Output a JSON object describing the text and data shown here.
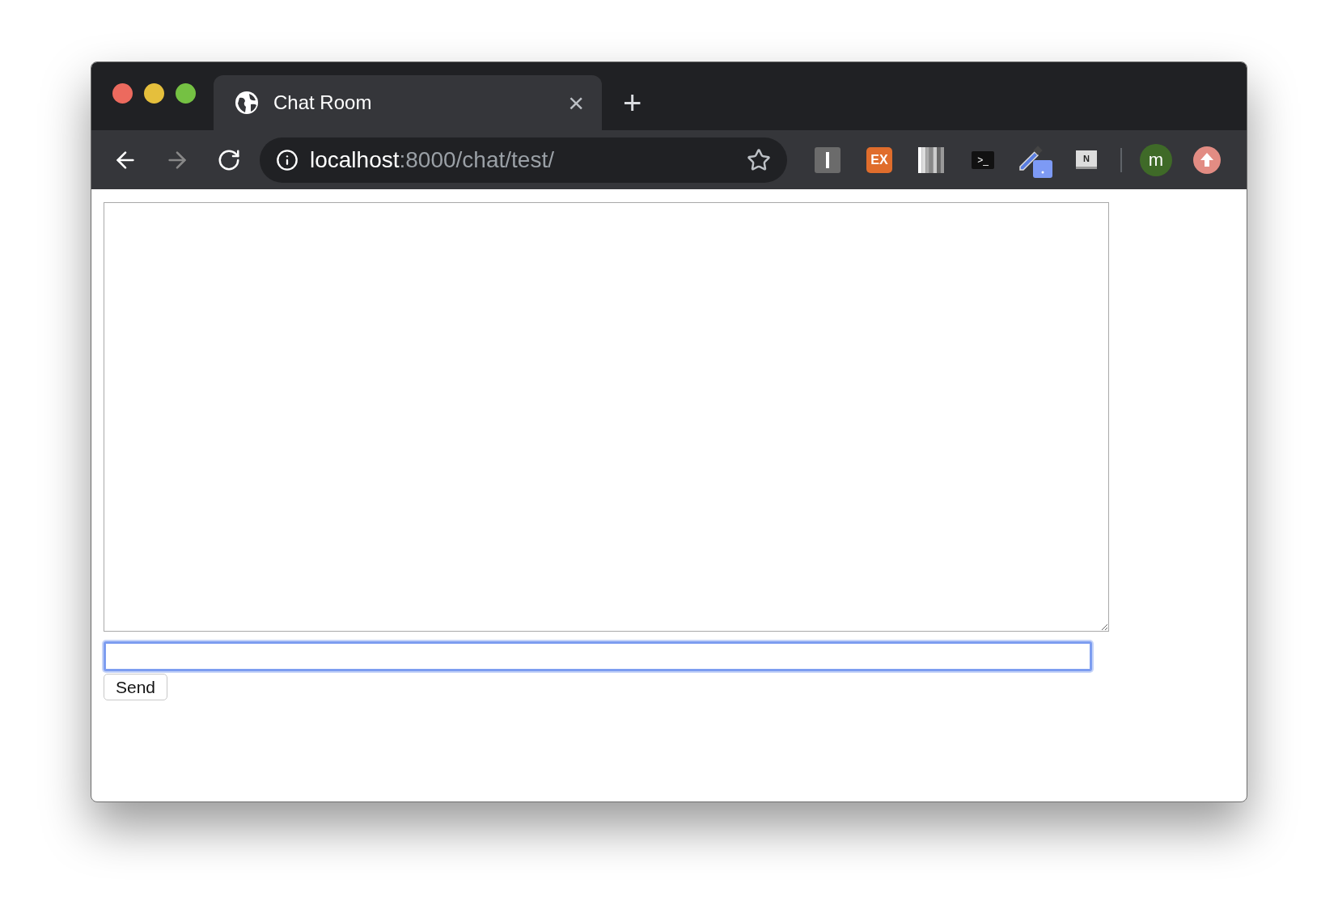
{
  "window": {
    "controls": [
      {
        "color": "#ec6a5e"
      },
      {
        "color": "#e5bf3c"
      },
      {
        "color": "#75c143"
      }
    ]
  },
  "tabs": [
    {
      "title": "Chat Room",
      "selected": true,
      "close": "×"
    }
  ],
  "new_tab": "+",
  "address_bar": {
    "host": "localhost",
    "path": ":8000/chat/test/"
  },
  "extensions": [
    {
      "kind": "bar"
    },
    {
      "kind": "label",
      "label": "EX"
    },
    {
      "kind": "stripes"
    },
    {
      "kind": "terminal",
      "label": ">_"
    },
    {
      "kind": "dropper"
    },
    {
      "kind": "screen",
      "label": "N"
    }
  ],
  "profile": {
    "initial": "m"
  },
  "page": {
    "message_input": {
      "focused": true
    },
    "send_button": "Send"
  }
}
